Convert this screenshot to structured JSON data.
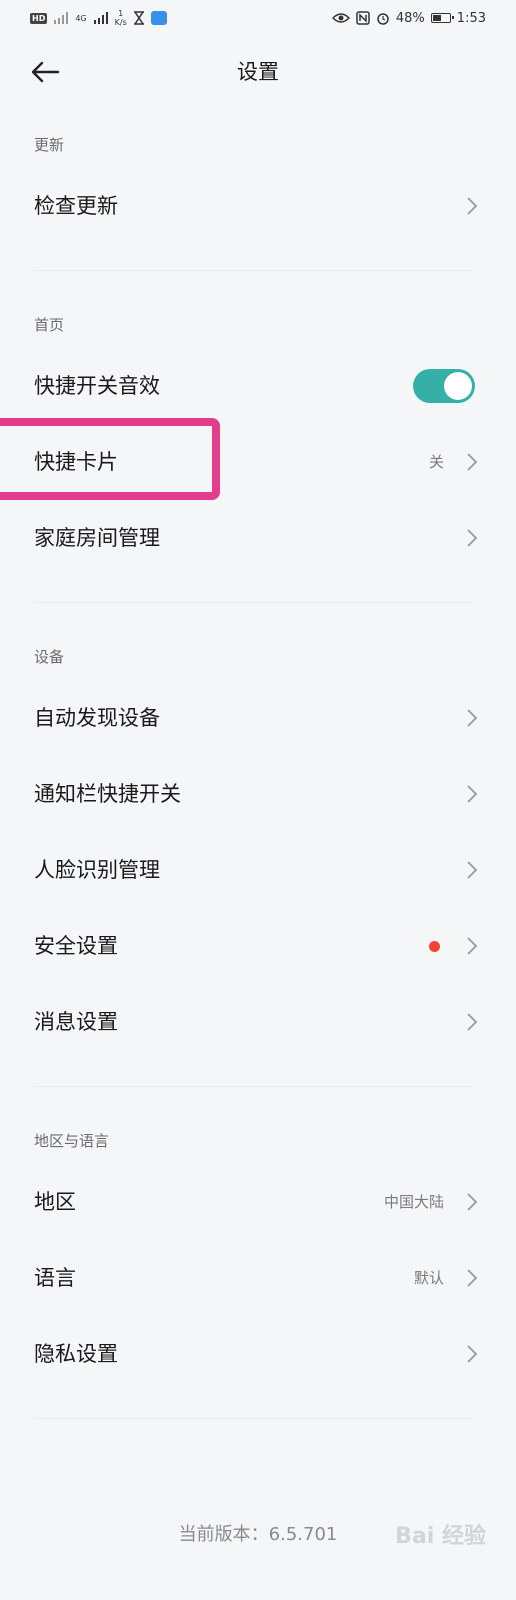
{
  "status_bar": {
    "hd_label": "HD",
    "net_type": "4G",
    "speed_value": "1",
    "speed_unit": "K/s",
    "battery_percent": "48%",
    "time": "1:53"
  },
  "header": {
    "title": "设置"
  },
  "sections": {
    "update": {
      "header": "更新",
      "check_update": "检查更新"
    },
    "home": {
      "header": "首页",
      "quick_switch_sound": "快捷开关音效",
      "quick_switch_sound_on": true,
      "quick_card": "快捷卡片",
      "quick_card_value": "关",
      "room_management": "家庭房间管理"
    },
    "device": {
      "header": "设备",
      "auto_discover": "自动发现设备",
      "notification_switch": "通知栏快捷开关",
      "face_recognition": "人脸识别管理",
      "security": "安全设置",
      "messages": "消息设置"
    },
    "region_language": {
      "header": "地区与语言",
      "region": "地区",
      "region_value": "中国大陆",
      "language": "语言",
      "language_value": "默认",
      "privacy": "隐私设置"
    }
  },
  "footer": {
    "version": "当前版本：6.5.701"
  },
  "watermark": "Bai 经验",
  "colors": {
    "toggle_on": "#35b0a7",
    "highlight": "#e23d8c",
    "badge_red": "#f44336"
  }
}
